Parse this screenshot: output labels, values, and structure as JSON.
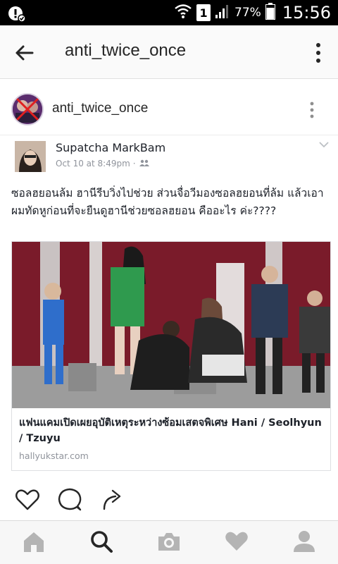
{
  "status_bar": {
    "sim_label": "1",
    "battery_percent": "77%",
    "time": "15:56",
    "icons": [
      "notification-icon",
      "wifi-icon",
      "sim-icon",
      "signal-icon",
      "battery-icon"
    ]
  },
  "app_bar": {
    "title": "anti_twice_once",
    "back_icon": "arrow-back-icon",
    "more_icon": "more-vertical-icon"
  },
  "post": {
    "username": "anti_twice_once",
    "more_icon": "more-vertical-icon"
  },
  "fb_post": {
    "author": "Supatcha MarkBam",
    "date": "Oct 10 at 8:49pm",
    "separator": "·",
    "audience_icon": "friends-icon",
    "text": "ซอลฮยอนล้ม ฮานีรีบวิ่งไปช่วย ส่วนจื่อวีมองซอลฮยอนที่ล้ม แล้วเอาผมทัดหูก่อนที่จะยืนดูฮานีช่วยซอลฮยอน คืออะไร ค่ะ????",
    "link": {
      "title": "แฟนแคมเปิดเผยอุบัติเหตุระหว่างซ้อมเสตจพิเศษ Hani / Seolhyun / Tzuyu",
      "domain": "hallyukstar.com"
    }
  },
  "actions": [
    "heart-icon",
    "comment-icon",
    "share-icon"
  ],
  "bottom_nav": [
    "home-icon",
    "search-icon",
    "camera-icon",
    "activity-heart-icon",
    "profile-icon"
  ],
  "colors": {
    "status_bg": "#000000",
    "app_bar_bg": "#fafafa",
    "text_primary": "#262626",
    "text_secondary": "#90949c",
    "nav_active": "#262626",
    "nav_inactive": "#b4b4b4"
  }
}
